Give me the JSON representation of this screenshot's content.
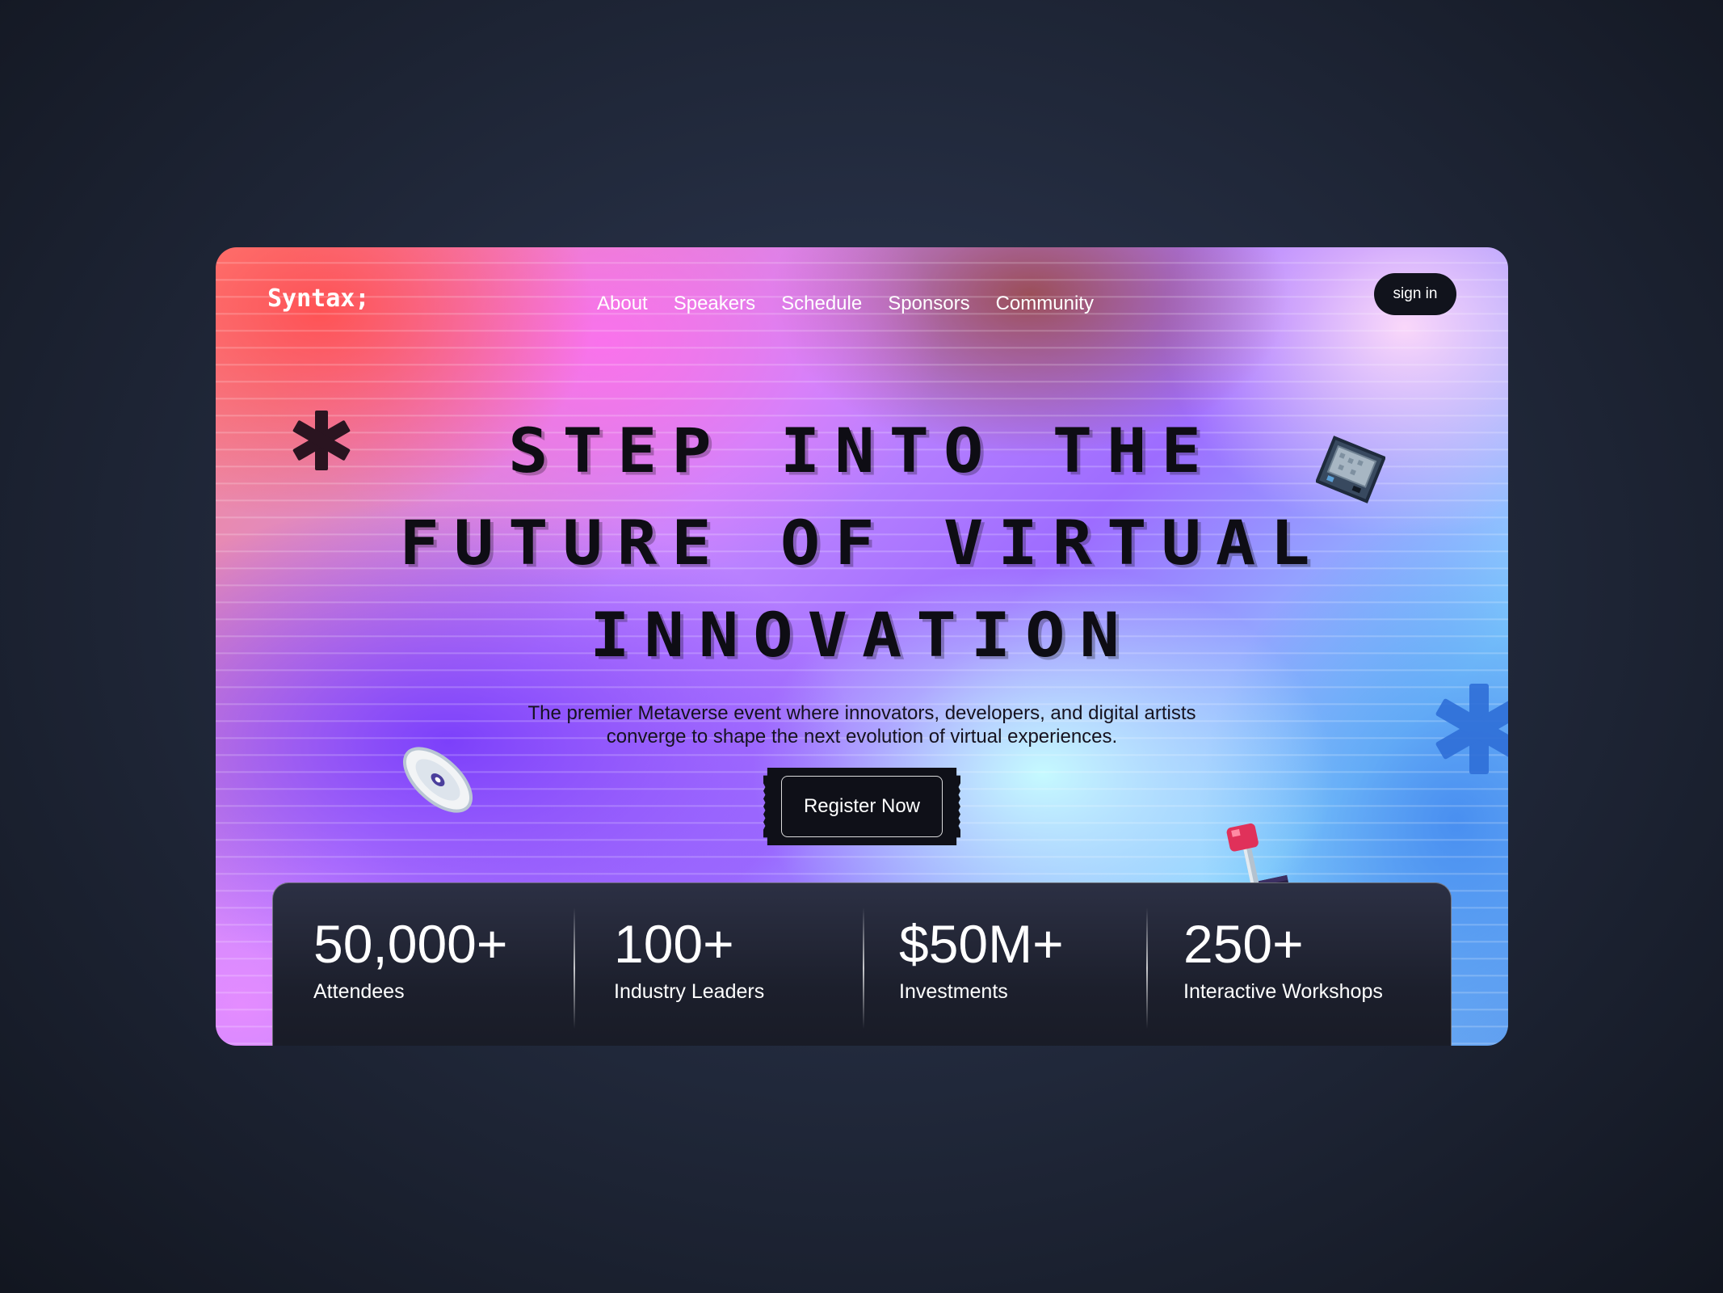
{
  "logo": "Syntax;",
  "nav": {
    "items": [
      "About",
      "Speakers",
      "Schedule",
      "Sponsors",
      "Community"
    ]
  },
  "header": {
    "signin_label": "sign in"
  },
  "hero": {
    "headline_lines": [
      "STEP INTO THE",
      "FUTURE OF VIRTUAL",
      "INNOVATION"
    ],
    "subtitle": "The premier Metaverse event where innovators, developers, and digital artists converge to shape the next evolution of virtual experiences.",
    "cta_label": "Register Now"
  },
  "stats": [
    {
      "value": "50,000+",
      "label": "Attendees"
    },
    {
      "value": "100+",
      "label": "Industry Leaders"
    },
    {
      "value": "$50M+",
      "label": "Investments"
    },
    {
      "value": "250+",
      "label": "Interactive Workshops"
    }
  ],
  "colors": {
    "page_bg": "#222a3d",
    "button_dark": "#11131c",
    "headline_text": "#0e0d14",
    "stats_bg": "#1c1f2c",
    "asterisk_dark": "#2a1420",
    "asterisk_blue": "#2f6fd8"
  },
  "icons": {
    "decor_left": "asterisk-icon",
    "decor_right": "asterisk-icon",
    "floppy": "pixel-device-icon",
    "disc": "pixel-disc-icon",
    "joystick": "pixel-joystick-icon"
  }
}
